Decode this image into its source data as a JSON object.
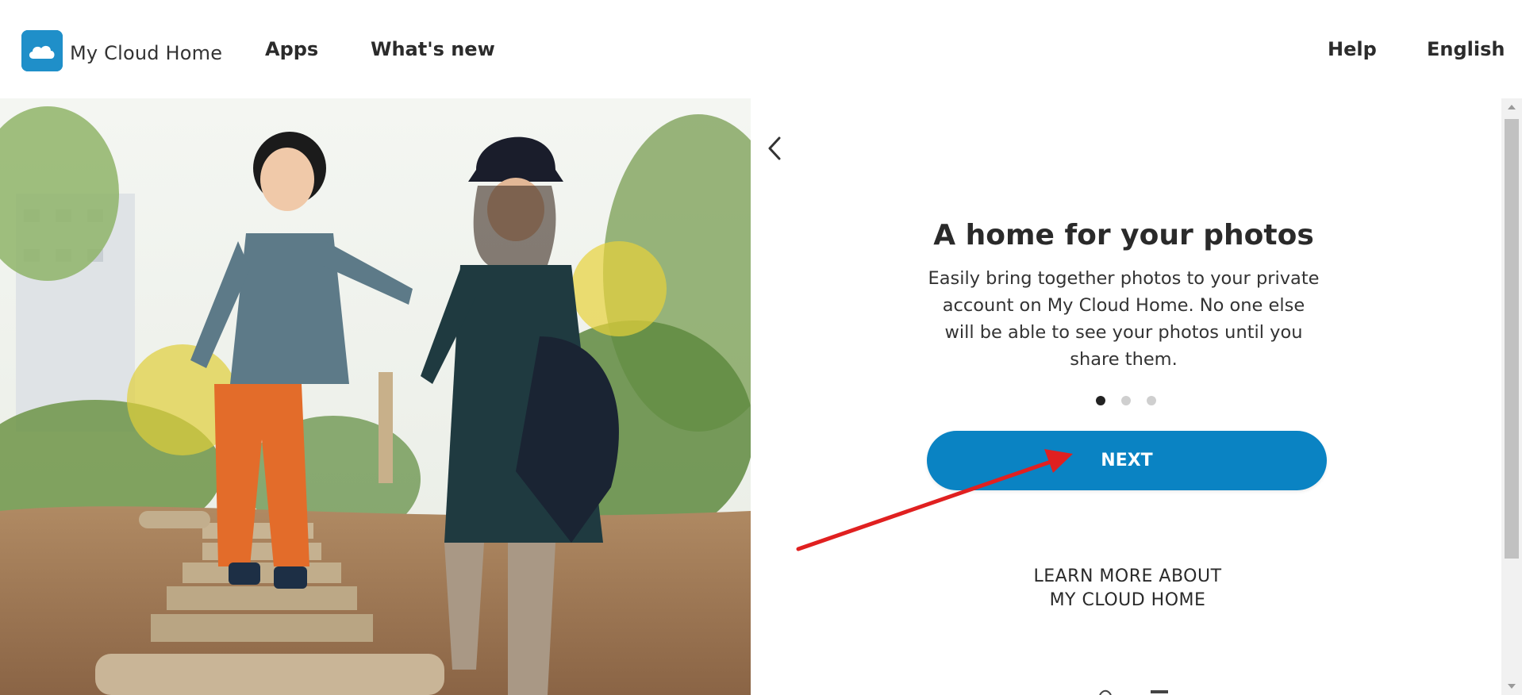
{
  "header": {
    "brand_name": "My Cloud Home",
    "brand_icon": "cloud-logo-icon",
    "nav": {
      "apps": "Apps",
      "whats_new": "What's new",
      "help": "Help",
      "language": "English"
    }
  },
  "hero": {
    "image_subject": "photo"
  },
  "onboarding": {
    "back_icon": "chevron-left-icon",
    "title": "A home for your photos",
    "description": "Easily bring together photos to your private account on My Cloud Home. No one else will be able to see your photos until you share them.",
    "carousel": {
      "total": 3,
      "active_index": 0
    },
    "next_label": "NEXT",
    "learn_more_line1": "LEARN MORE ABOUT",
    "learn_more_line2": "MY CLOUD HOME"
  },
  "colors": {
    "brand_blue": "#1f8fc9",
    "button_blue": "#0a83c3",
    "annotation_red": "#e02020"
  }
}
